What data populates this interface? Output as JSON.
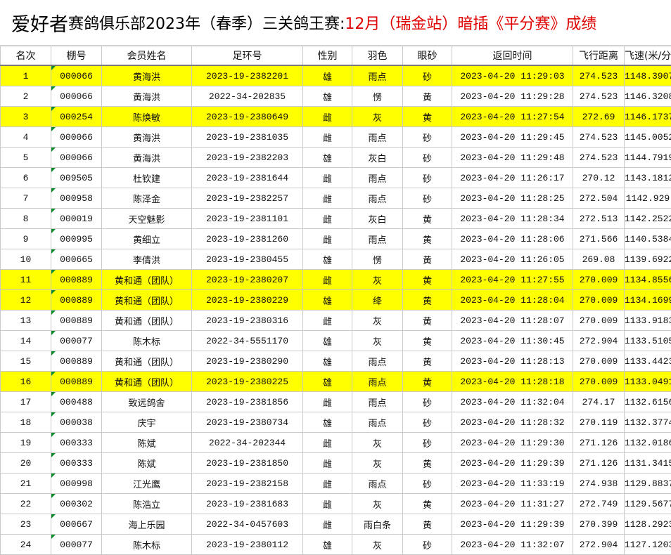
{
  "title": {
    "brand": "爱好者",
    "club": "赛鸽俱乐部2023年（春季）三关鸽王赛:",
    "highlight": "12月（瑞金站）暗插《平分赛》成绩"
  },
  "columns": [
    "名次",
    "棚号",
    "会员姓名",
    "足环号",
    "性别",
    "羽色",
    "眼砂",
    "返回时间",
    "飞行距离",
    "飞速(米/分)"
  ],
  "colors": {
    "highlight_row": "#ffff00",
    "title_red": "#e00000",
    "cell_marker": "#0a8a2a"
  },
  "rows": [
    {
      "rank": "1",
      "loft": "000066",
      "name": "黄海洪",
      "ring": "2023-19-2382201",
      "sex": "雄",
      "color": "雨点",
      "eye": "砂",
      "time": "2023-04-20 11:29:03",
      "dist": "274.523",
      "speed": "1148.3907",
      "highlight": true
    },
    {
      "rank": "2",
      "loft": "000066",
      "name": "黄海洪",
      "ring": "2022-34-202835",
      "sex": "雄",
      "color": "愣",
      "eye": "黄",
      "time": "2023-04-20 11:29:28",
      "dist": "274.523",
      "speed": "1146.3208",
      "highlight": false
    },
    {
      "rank": "3",
      "loft": "000254",
      "name": "陈焕敏",
      "ring": "2023-19-2380649",
      "sex": "雌",
      "color": "灰",
      "eye": "黄",
      "time": "2023-04-20 11:27:54",
      "dist": "272.69",
      "speed": "1146.1737",
      "highlight": true
    },
    {
      "rank": "4",
      "loft": "000066",
      "name": "黄海洪",
      "ring": "2023-19-2381035",
      "sex": "雌",
      "color": "雨点",
      "eye": "砂",
      "time": "2023-04-20 11:29:45",
      "dist": "274.523",
      "speed": "1145.0052",
      "highlight": false
    },
    {
      "rank": "5",
      "loft": "000066",
      "name": "黄海洪",
      "ring": "2023-19-2382203",
      "sex": "雄",
      "color": "灰白",
      "eye": "砂",
      "time": "2023-04-20 11:29:48",
      "dist": "274.523",
      "speed": "1144.7919",
      "highlight": false
    },
    {
      "rank": "6",
      "loft": "009505",
      "name": "杜钦建",
      "ring": "2023-19-2381644",
      "sex": "雌",
      "color": "雨点",
      "eye": "砂",
      "time": "2023-04-20 11:26:17",
      "dist": "270.12",
      "speed": "1143.1812",
      "highlight": false
    },
    {
      "rank": "7",
      "loft": "000958",
      "name": "陈泽金",
      "ring": "2023-19-2382257",
      "sex": "雌",
      "color": "雨点",
      "eye": "砂",
      "time": "2023-04-20 11:28:25",
      "dist": "272.504",
      "speed": "1142.929",
      "highlight": false
    },
    {
      "rank": "8",
      "loft": "000019",
      "name": "天空魅影",
      "ring": "2023-19-2381101",
      "sex": "雌",
      "color": "灰白",
      "eye": "黄",
      "time": "2023-04-20 11:28:34",
      "dist": "272.513",
      "speed": "1142.2522",
      "highlight": false
    },
    {
      "rank": "9",
      "loft": "000995",
      "name": "黄细立",
      "ring": "2023-19-2381260",
      "sex": "雌",
      "color": "雨点",
      "eye": "黄",
      "time": "2023-04-20 11:28:06",
      "dist": "271.566",
      "speed": "1140.5384",
      "highlight": false
    },
    {
      "rank": "10",
      "loft": "000665",
      "name": "李倩洪",
      "ring": "2023-19-2380455",
      "sex": "雄",
      "color": "愣",
      "eye": "黄",
      "time": "2023-04-20 11:26:05",
      "dist": "269.08",
      "speed": "1139.6922",
      "highlight": false
    },
    {
      "rank": "11",
      "loft": "000889",
      "name": "黄和通（团队）",
      "ring": "2023-19-2380207",
      "sex": "雌",
      "color": "灰",
      "eye": "黄",
      "time": "2023-04-20 11:27:55",
      "dist": "270.009",
      "speed": "1134.8556",
      "highlight": true
    },
    {
      "rank": "12",
      "loft": "000889",
      "name": "黄和通（团队）",
      "ring": "2023-19-2380229",
      "sex": "雄",
      "color": "绛",
      "eye": "黄",
      "time": "2023-04-20 11:28:04",
      "dist": "270.009",
      "speed": "1134.1699",
      "highlight": true
    },
    {
      "rank": "13",
      "loft": "000889",
      "name": "黄和通（团队）",
      "ring": "2023-19-2380316",
      "sex": "雌",
      "color": "灰",
      "eye": "黄",
      "time": "2023-04-20 11:28:07",
      "dist": "270.009",
      "speed": "1133.9183",
      "highlight": false
    },
    {
      "rank": "14",
      "loft": "000077",
      "name": "陈木标",
      "ring": "2022-34-5551170",
      "sex": "雄",
      "color": "灰",
      "eye": "黄",
      "time": "2023-04-20 11:30:45",
      "dist": "272.904",
      "speed": "1133.5105",
      "highlight": false
    },
    {
      "rank": "15",
      "loft": "000889",
      "name": "黄和通（团队）",
      "ring": "2023-19-2380290",
      "sex": "雄",
      "color": "雨点",
      "eye": "黄",
      "time": "2023-04-20 11:28:13",
      "dist": "270.009",
      "speed": "1133.4423",
      "highlight": false
    },
    {
      "rank": "16",
      "loft": "000889",
      "name": "黄和通（团队）",
      "ring": "2023-19-2380225",
      "sex": "雄",
      "color": "雨点",
      "eye": "黄",
      "time": "2023-04-20 11:28:18",
      "dist": "270.009",
      "speed": "1133.0491",
      "highlight": true
    },
    {
      "rank": "17",
      "loft": "000488",
      "name": "致远鸽舍",
      "ring": "2023-19-2381856",
      "sex": "雌",
      "color": "雨点",
      "eye": "砂",
      "time": "2023-04-20 11:32:04",
      "dist": "274.17",
      "speed": "1132.6156",
      "highlight": false
    },
    {
      "rank": "18",
      "loft": "000038",
      "name": "庆宇",
      "ring": "2023-19-2380734",
      "sex": "雄",
      "color": "雨点",
      "eye": "砂",
      "time": "2023-04-20 11:28:32",
      "dist": "270.119",
      "speed": "1132.3774",
      "highlight": false
    },
    {
      "rank": "19",
      "loft": "000333",
      "name": "陈斌",
      "ring": "2022-34-202344",
      "sex": "雌",
      "color": "灰",
      "eye": "砂",
      "time": "2023-04-20 11:29:30",
      "dist": "271.126",
      "speed": "1132.0186",
      "highlight": false
    },
    {
      "rank": "20",
      "loft": "000333",
      "name": "陈斌",
      "ring": "2023-19-2381850",
      "sex": "雌",
      "color": "灰",
      "eye": "黄",
      "time": "2023-04-20 11:29:39",
      "dist": "271.126",
      "speed": "1131.3415",
      "highlight": false
    },
    {
      "rank": "21",
      "loft": "000998",
      "name": "江光鹰",
      "ring": "2023-19-2382158",
      "sex": "雌",
      "color": "雨点",
      "eye": "砂",
      "time": "2023-04-20 11:33:19",
      "dist": "274.938",
      "speed": "1129.8837",
      "highlight": false
    },
    {
      "rank": "22",
      "loft": "000302",
      "name": "陈浩立",
      "ring": "2023-19-2381683",
      "sex": "雌",
      "color": "灰",
      "eye": "黄",
      "time": "2023-04-20 11:31:27",
      "dist": "272.749",
      "speed": "1129.5677",
      "highlight": false
    },
    {
      "rank": "23",
      "loft": "000667",
      "name": "海上乐园",
      "ring": "2022-34-0457603",
      "sex": "雌",
      "color": "雨白条",
      "eye": "黄",
      "time": "2023-04-20 11:29:39",
      "dist": "270.399",
      "speed": "1128.2923",
      "highlight": false
    },
    {
      "rank": "24",
      "loft": "000077",
      "name": "陈木标",
      "ring": "2023-19-2380112",
      "sex": "雄",
      "color": "灰",
      "eye": "砂",
      "time": "2023-04-20 11:32:07",
      "dist": "272.904",
      "speed": "1127.1203",
      "highlight": false
    }
  ]
}
